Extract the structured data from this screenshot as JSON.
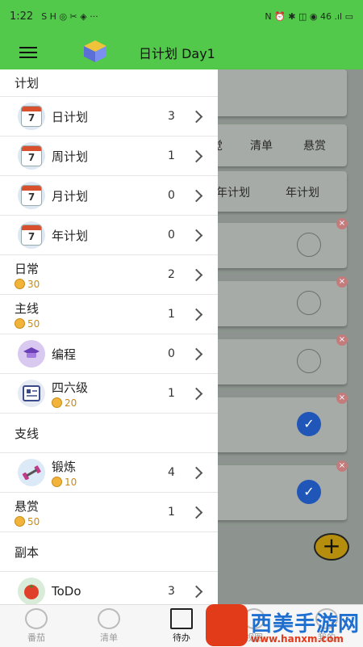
{
  "status": {
    "time": "1:22",
    "left_icons": "S H ◎ ✂ ◈ ···",
    "right_icons": "N ⏰ ✱ ◫ ◉ 46 .ıl ▭"
  },
  "appbar": {
    "title": "日计划 Day1"
  },
  "background": {
    "tabs_row1": [
      "觉",
      "清单",
      "悬赏"
    ],
    "tabs_row2": [
      "年计划",
      "年计划"
    ]
  },
  "drawer": {
    "section_plan": "计划",
    "plans": [
      {
        "label": "日计划",
        "count": "3",
        "icon": "calendar-icon",
        "day": "7"
      },
      {
        "label": "周计划",
        "count": "1",
        "icon": "calendar-icon",
        "day": "7"
      },
      {
        "label": "月计划",
        "count": "0",
        "icon": "calendar-icon",
        "day": "7"
      },
      {
        "label": "年计划",
        "count": "0",
        "icon": "calendar-icon",
        "day": "7"
      }
    ],
    "daily": {
      "label": "日常",
      "coins": "30",
      "count": "2"
    },
    "mainline": {
      "label": "主线",
      "coins": "50",
      "count": "1"
    },
    "programming": {
      "label": "编程",
      "count": "0"
    },
    "cet": {
      "label": "四六级",
      "coins": "20",
      "count": "1"
    },
    "section_side": "支线",
    "exercise": {
      "label": "锻炼",
      "coins": "10",
      "count": "4"
    },
    "bounty": {
      "label": "悬赏",
      "coins": "50",
      "count": "1"
    },
    "section_instance": "副本",
    "todo": {
      "label": "ToDo",
      "count": "3"
    }
  },
  "bottomnav": {
    "items": [
      {
        "label": "番茄"
      },
      {
        "label": "清单"
      },
      {
        "label": "待办"
      },
      {
        "label": "视图"
      },
      {
        "label": "我的"
      }
    ]
  },
  "watermark": {
    "title": "西美手游网",
    "url": "www.hanxm.com"
  }
}
